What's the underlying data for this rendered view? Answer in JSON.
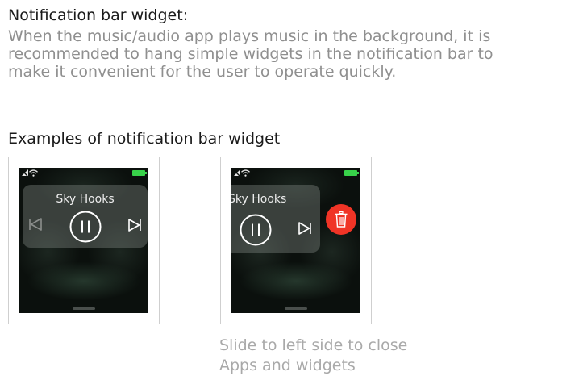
{
  "header": {
    "title": "Notification bar widget:",
    "description_lines": [
      "When the music/audio app plays music in the background, it is",
      "recommended to hang simple widgets in the notification bar to",
      "make it convenient for the user to operate quickly."
    ]
  },
  "examples": {
    "title": "Examples of notification bar widget",
    "widget1": {
      "song_title": "Sky Hooks"
    },
    "widget2": {
      "song_title": "Sky Hooks"
    },
    "caption_lines": [
      "Slide to left side to close",
      "Apps and widgets"
    ]
  },
  "colors": {
    "battery": "#38d24a",
    "delete_button": "#f03426"
  }
}
